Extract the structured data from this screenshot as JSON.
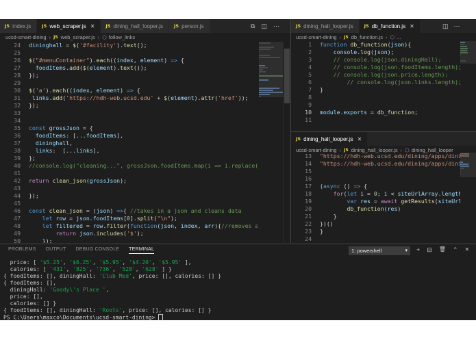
{
  "editor_left": {
    "tabs": [
      {
        "label": "index.js",
        "active": false
      },
      {
        "label": "web_scraper.js",
        "active": true
      },
      {
        "label": "dining_hall_looper.js",
        "active": false
      },
      {
        "label": "person.js",
        "active": false
      }
    ],
    "breadcrumb": [
      "ucsd-smart-dining",
      "web_scraper.js",
      "follow_links"
    ],
    "lines": [
      {
        "n": "24",
        "t": [
          [
            "dininghall",
            "var"
          ],
          [
            " = ",
            "txt"
          ],
          [
            "$",
            "fn"
          ],
          [
            "(",
            "txt"
          ],
          [
            "'#facility'",
            "str"
          ],
          [
            ").",
            "txt"
          ],
          [
            "text",
            "fn"
          ],
          [
            "();",
            "txt"
          ]
        ]
      },
      {
        "n": "25",
        "t": []
      },
      {
        "n": "26",
        "t": [
          [
            "$",
            "fn"
          ],
          [
            "(",
            "txt"
          ],
          [
            "\"#menuContainer\"",
            "str"
          ],
          [
            ").",
            "txt"
          ],
          [
            "each",
            "fn"
          ],
          [
            "((",
            "txt"
          ],
          [
            "index",
            "var"
          ],
          [
            ", ",
            "txt"
          ],
          [
            "element",
            "var"
          ],
          [
            ") ",
            "txt"
          ],
          [
            "=>",
            "kw"
          ],
          [
            " {",
            "txt"
          ]
        ]
      },
      {
        "n": "27",
        "t": [
          [
            "  foodItems",
            "var"
          ],
          [
            ".",
            "txt"
          ],
          [
            "add",
            "fn"
          ],
          [
            "(",
            "txt"
          ],
          [
            "$",
            "fn"
          ],
          [
            "(",
            "txt"
          ],
          [
            "element",
            "var"
          ],
          [
            ").",
            "txt"
          ],
          [
            "text",
            "fn"
          ],
          [
            "());",
            "txt"
          ]
        ]
      },
      {
        "n": "28",
        "t": [
          [
            "});",
            "txt"
          ]
        ]
      },
      {
        "n": "29",
        "t": []
      },
      {
        "n": "30",
        "t": [
          [
            "$",
            "fn"
          ],
          [
            "(",
            "txt"
          ],
          [
            "'a'",
            "str"
          ],
          [
            ").",
            "txt"
          ],
          [
            "each",
            "fn"
          ],
          [
            "((",
            "txt"
          ],
          [
            "index",
            "var"
          ],
          [
            ", ",
            "txt"
          ],
          [
            "element",
            "var"
          ],
          [
            ") ",
            "txt"
          ],
          [
            "=>",
            "kw"
          ],
          [
            " {",
            "txt"
          ]
        ]
      },
      {
        "n": "31",
        "t": [
          [
            " links",
            "var"
          ],
          [
            ".",
            "txt"
          ],
          [
            "add",
            "fn"
          ],
          [
            "(",
            "txt"
          ],
          [
            "'https://hdh-web.ucsd.edu'",
            "str"
          ],
          [
            " + ",
            "txt"
          ],
          [
            "$",
            "fn"
          ],
          [
            "(",
            "txt"
          ],
          [
            "element",
            "var"
          ],
          [
            ").",
            "txt"
          ],
          [
            "attr",
            "fn"
          ],
          [
            "(",
            "txt"
          ],
          [
            "'href'",
            "str"
          ],
          [
            "));",
            "txt"
          ]
        ]
      },
      {
        "n": "32",
        "t": [
          [
            "});",
            "txt"
          ]
        ]
      },
      {
        "n": "33",
        "t": []
      },
      {
        "n": "34",
        "t": []
      },
      {
        "n": "35",
        "t": [
          [
            "const",
            "kw"
          ],
          [
            " ",
            "txt"
          ],
          [
            "grossJson",
            "var"
          ],
          [
            " = {",
            "txt"
          ]
        ]
      },
      {
        "n": "36",
        "t": [
          [
            "  foodItems",
            "var"
          ],
          [
            ": [...",
            "txt"
          ],
          [
            "foodItems",
            "var"
          ],
          [
            "],",
            "txt"
          ]
        ]
      },
      {
        "n": "37",
        "t": [
          [
            "  dininghall",
            "var"
          ],
          [
            ",",
            "txt"
          ]
        ]
      },
      {
        "n": "38",
        "t": [
          [
            "  links",
            "var"
          ],
          [
            ":  [...",
            "txt"
          ],
          [
            "links",
            "var"
          ],
          [
            "],",
            "txt"
          ]
        ]
      },
      {
        "n": "39",
        "t": [
          [
            "};",
            "txt"
          ]
        ]
      },
      {
        "n": "40",
        "t": [
          [
            "//console.log(\"cleaning...\", grossJson.foodItems.map(i => i.replace(/\\s\\s+/g",
            "com"
          ]
        ]
      },
      {
        "n": "41",
        "t": []
      },
      {
        "n": "42",
        "t": [
          [
            "return",
            "ctl"
          ],
          [
            " ",
            "txt"
          ],
          [
            "clean_json",
            "fn"
          ],
          [
            "(",
            "txt"
          ],
          [
            "grossJson",
            "var"
          ],
          [
            ");",
            "txt"
          ]
        ]
      },
      {
        "n": "43",
        "t": []
      },
      {
        "n": "44",
        "t": [
          [
            "});",
            "txt"
          ]
        ]
      },
      {
        "n": "45",
        "t": []
      },
      {
        "n": "46",
        "t": [
          [
            "const",
            "kw"
          ],
          [
            " ",
            "txt"
          ],
          [
            "clean_json",
            "fn"
          ],
          [
            " = (",
            "txt"
          ],
          [
            "json",
            "var"
          ],
          [
            ") ",
            "txt"
          ],
          [
            "=>",
            "kw"
          ],
          [
            "{ ",
            "txt"
          ],
          [
            "//takes in a json and cleans data",
            "com"
          ]
        ]
      },
      {
        "n": "47",
        "t": [
          [
            "    ",
            "txt"
          ],
          [
            "let",
            "kw"
          ],
          [
            " ",
            "txt"
          ],
          [
            "row",
            "var"
          ],
          [
            " = ",
            "txt"
          ],
          [
            "json",
            "var"
          ],
          [
            ".",
            "txt"
          ],
          [
            "foodItems",
            "var"
          ],
          [
            "[",
            "txt"
          ],
          [
            "0",
            "num"
          ],
          [
            "].",
            "txt"
          ],
          [
            "split",
            "fn"
          ],
          [
            "(",
            "txt"
          ],
          [
            "\"\\n\"",
            "str"
          ],
          [
            ");",
            "txt"
          ]
        ]
      },
      {
        "n": "48",
        "t": [
          [
            "    ",
            "txt"
          ],
          [
            "let",
            "kw"
          ],
          [
            " ",
            "txt"
          ],
          [
            "filtered",
            "var"
          ],
          [
            " = ",
            "txt"
          ],
          [
            "row",
            "var"
          ],
          [
            ".",
            "txt"
          ],
          [
            "filter",
            "fn"
          ],
          [
            "(",
            "txt"
          ],
          [
            "function",
            "kw"
          ],
          [
            "(",
            "txt"
          ],
          [
            "json",
            "var"
          ],
          [
            ", ",
            "txt"
          ],
          [
            "index",
            "var"
          ],
          [
            ", ",
            "txt"
          ],
          [
            "arr",
            "var"
          ],
          [
            "){",
            "txt"
          ],
          [
            "//removes anything wi",
            "com"
          ]
        ]
      },
      {
        "n": "49",
        "t": [
          [
            "        ",
            "txt"
          ],
          [
            "return",
            "ctl"
          ],
          [
            " ",
            "txt"
          ],
          [
            "json",
            "var"
          ],
          [
            ".",
            "txt"
          ],
          [
            "includes",
            "fn"
          ],
          [
            "(",
            "txt"
          ],
          [
            "'$'",
            "str"
          ],
          [
            ");",
            "txt"
          ]
        ]
      },
      {
        "n": "50",
        "t": [
          [
            "    ",
            "txt"
          ],
          [
            "});",
            "txt"
          ]
        ]
      }
    ]
  },
  "editor_top_right": {
    "tabs": [
      {
        "label": "dining_hall_looper.js",
        "active": false
      },
      {
        "label": "db_function.js",
        "active": true
      }
    ],
    "breadcrumb": [
      "ucsd-smart-dining",
      "db_function.js",
      "..."
    ],
    "lines": [
      {
        "n": "1",
        "t": [
          [
            "function",
            "kw"
          ],
          [
            " ",
            "txt"
          ],
          [
            "db_function",
            "fn"
          ],
          [
            "(",
            "txt"
          ],
          [
            "json",
            "var"
          ],
          [
            "){",
            "txt"
          ]
        ]
      },
      {
        "n": "2",
        "t": [
          [
            "    ",
            "txt"
          ],
          [
            "console",
            "var"
          ],
          [
            ".",
            "txt"
          ],
          [
            "log",
            "fn"
          ],
          [
            "(",
            "txt"
          ],
          [
            "json",
            "var"
          ],
          [
            ");",
            "txt"
          ]
        ]
      },
      {
        "n": "3",
        "t": [
          [
            "    ",
            "txt"
          ],
          [
            "// console.log(json.diningHall);",
            "com"
          ]
        ]
      },
      {
        "n": "4",
        "t": [
          [
            "    ",
            "txt"
          ],
          [
            "// console.log(json.foodItems.length);",
            "com"
          ]
        ]
      },
      {
        "n": "5",
        "t": [
          [
            "    ",
            "txt"
          ],
          [
            "// console.log(json.price.length);",
            "com"
          ]
        ]
      },
      {
        "n": "6",
        "t": [
          [
            "        ",
            "txt"
          ],
          [
            "// console.log(json.links.length);",
            "com"
          ]
        ]
      },
      {
        "n": "7",
        "t": [
          [
            "}",
            "txt"
          ]
        ]
      },
      {
        "n": "8",
        "t": []
      },
      {
        "n": "9",
        "t": []
      },
      {
        "n": "10",
        "t": [
          [
            "module",
            "var"
          ],
          [
            ".",
            "txt"
          ],
          [
            "exports",
            "var"
          ],
          [
            " = ",
            "txt"
          ],
          [
            "db_function",
            "fn"
          ],
          [
            ";",
            "txt"
          ]
        ]
      },
      {
        "n": "11",
        "t": []
      }
    ]
  },
  "editor_bottom_right": {
    "tabs": [
      {
        "label": "dining_hall_looper.js",
        "active": true
      }
    ],
    "breadcrumb": [
      "ucsd-smart-dining",
      "dining_hall_looper.js",
      "dining_hall_looper"
    ],
    "lines": [
      {
        "n": "13",
        "t": [
          [
            "\"https://hdh-web.ucsd.edu/dining/apps/diningserv",
            "str"
          ]
        ]
      },
      {
        "n": "14",
        "t": [
          [
            "\"https://hdh-web.ucsd.edu/dining/apps/diningserv",
            "str"
          ]
        ]
      },
      {
        "n": "15",
        "t": []
      },
      {
        "n": "16",
        "t": []
      },
      {
        "n": "17",
        "t": [
          [
            "(",
            "txt"
          ],
          [
            "async",
            "kw"
          ],
          [
            " () ",
            "txt"
          ],
          [
            "=>",
            "kw"
          ],
          [
            " {",
            "txt"
          ]
        ]
      },
      {
        "n": "18",
        "t": [
          [
            "    ",
            "txt"
          ],
          [
            "for",
            "ctl"
          ],
          [
            "(",
            "txt"
          ],
          [
            "let",
            "kw"
          ],
          [
            " ",
            "txt"
          ],
          [
            "i",
            "var"
          ],
          [
            " = ",
            "txt"
          ],
          [
            "0",
            "num"
          ],
          [
            "; ",
            "txt"
          ],
          [
            "i",
            "var"
          ],
          [
            " < ",
            "txt"
          ],
          [
            "siteUrlArray",
            "var"
          ],
          [
            ".",
            "txt"
          ],
          [
            "length",
            "var"
          ],
          [
            "; ",
            "txt"
          ],
          [
            "i",
            "var"
          ],
          [
            "++",
            "txt"
          ]
        ]
      },
      {
        "n": "19",
        "t": [
          [
            "        ",
            "txt"
          ],
          [
            "var",
            "kw"
          ],
          [
            " ",
            "txt"
          ],
          [
            "res",
            "var"
          ],
          [
            " = ",
            "txt"
          ],
          [
            "await",
            "ctl"
          ],
          [
            " ",
            "txt"
          ],
          [
            "getResults",
            "fn"
          ],
          [
            "(",
            "txt"
          ],
          [
            "siteUrlArray",
            "var"
          ],
          [
            "[",
            "txt"
          ]
        ]
      },
      {
        "n": "20",
        "t": [
          [
            "        ",
            "txt"
          ],
          [
            "db_function",
            "fn"
          ],
          [
            "(",
            "txt"
          ],
          [
            "res",
            "var"
          ],
          [
            ")",
            "txt"
          ]
        ]
      },
      {
        "n": "21",
        "t": [
          [
            "    }",
            "txt"
          ]
        ]
      },
      {
        "n": "22",
        "t": [
          [
            "})()",
            "txt"
          ]
        ]
      },
      {
        "n": "23",
        "t": [
          [
            "}",
            "txt"
          ]
        ]
      },
      {
        "n": "24",
        "t": []
      }
    ]
  },
  "panel": {
    "tabs": [
      {
        "label": "PROBLEMS",
        "active": false
      },
      {
        "label": "OUTPUT",
        "active": false
      },
      {
        "label": "DEBUG CONSOLE",
        "active": false
      },
      {
        "label": "TERMINAL",
        "active": true
      }
    ],
    "shell": "1: powershell",
    "terminal_lines": [
      [
        [
          "  price: [ ",
          "p"
        ],
        [
          "'$5.25'",
          "s"
        ],
        [
          ", ",
          "p"
        ],
        [
          "'$6.25'",
          "s"
        ],
        [
          ", ",
          "p"
        ],
        [
          "'$5.95'",
          "s"
        ],
        [
          ", ",
          "p"
        ],
        [
          "'$4.20'",
          "s"
        ],
        [
          ", ",
          "p"
        ],
        [
          "'$5.95'",
          "s"
        ],
        [
          " ],",
          "p"
        ]
      ],
      [
        [
          "  calories: [ ",
          "p"
        ],
        [
          "'431'",
          "s"
        ],
        [
          ", ",
          "p"
        ],
        [
          "'825'",
          "s"
        ],
        [
          ", ",
          "p"
        ],
        [
          "'736'",
          "s"
        ],
        [
          ", ",
          "p"
        ],
        [
          "'528'",
          "s"
        ],
        [
          ", ",
          "p"
        ],
        [
          "'628'",
          "s"
        ],
        [
          " ] }",
          "p"
        ]
      ],
      [
        [
          "{ foodItems: [], diningHall: ",
          "p"
        ],
        [
          "'Club Med'",
          "s"
        ],
        [
          ", price: [], calories: [] }",
          "p"
        ]
      ],
      [
        [
          "{ foodItems: [],",
          "p"
        ]
      ],
      [
        [
          "  diningHall: ",
          "p"
        ],
        [
          "'Goody\\'s Place '",
          "s"
        ],
        [
          ",",
          "p"
        ]
      ],
      [
        [
          "  price: [],",
          "p"
        ]
      ],
      [
        [
          "  calories: [] }",
          "p"
        ]
      ],
      [
        [
          "{ foodItems: [], diningHall: ",
          "p"
        ],
        [
          "'Roots'",
          "s"
        ],
        [
          ", price: [], calories: [] }",
          "p"
        ]
      ],
      [
        [
          "PS C:\\Users\\maxco\\Documents\\ucsd-smart-dining> ",
          "p"
        ]
      ]
    ]
  },
  "icons": {
    "split": "⧉",
    "columns": "◫",
    "more": "⋯",
    "add": "+",
    "split_term": "⊟",
    "trash": "🗑",
    "up": "⌃",
    "close": "✕",
    "dropdown": "▾",
    "chevron": "›",
    "symbol": "⬡",
    "js": "JS"
  }
}
